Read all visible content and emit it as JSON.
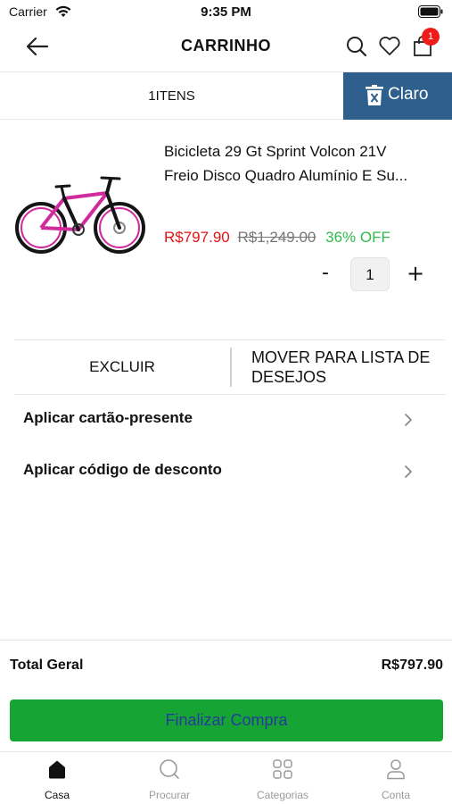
{
  "status_bar": {
    "carrier": "Carrier",
    "time": "9:35 PM"
  },
  "header": {
    "title": "CARRINHO",
    "cart_count": "1"
  },
  "toolbar": {
    "items_label": "1ITENS",
    "clear_label": "Claro"
  },
  "product": {
    "name_line1": "Bicicleta 29 Gt Sprint Volcon 21V",
    "name_line2": "Freio Disco Quadro Alumínio E Su...",
    "price": "R$797.90",
    "old_price": "R$1,249.00",
    "discount": "36% OFF",
    "quantity": "1",
    "qty_minus": "-",
    "qty_plus": "+"
  },
  "actions": {
    "delete_label": "EXCLUIR",
    "wishlist_label": "MOVER PARA LISTA DE DESEJOS"
  },
  "options": {
    "gift_card": "Aplicar cartão-presente",
    "discount_code": "Aplicar código de desconto"
  },
  "totals": {
    "label": "Total Geral",
    "amount": "R$797.90"
  },
  "checkout": {
    "label": "Finalizar Compra"
  },
  "tabbar": [
    {
      "label": "Casa",
      "icon": "home-icon"
    },
    {
      "label": "Procurar",
      "icon": "search-icon"
    },
    {
      "label": "Categorias",
      "icon": "grid-icon"
    },
    {
      "label": "Conta",
      "icon": "user-icon"
    }
  ],
  "colors": {
    "accent_blue": "#2f5f8d",
    "price_red": "#e31414",
    "discount_green": "#2fbb4a",
    "checkout_green": "#16a534",
    "checkout_text": "#263b9a",
    "badge_red": "#f01c1c"
  }
}
